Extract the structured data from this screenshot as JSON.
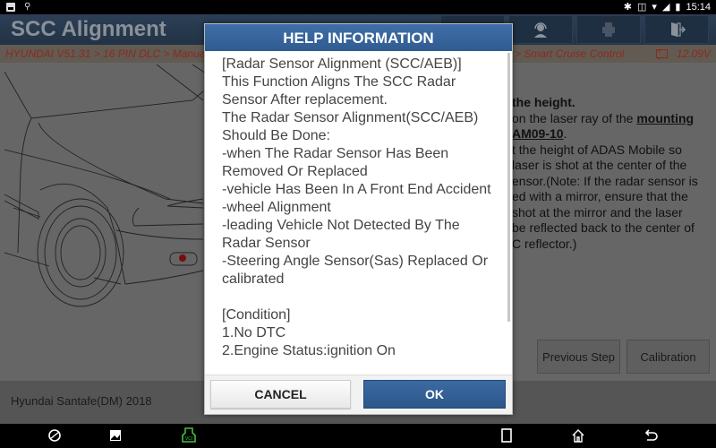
{
  "status_bar": {
    "time": "15:14",
    "left_icons": [
      "image-notification-icon",
      "usb-debug-icon"
    ],
    "right_icons": [
      "bluetooth-icon",
      "vibrate-icon",
      "wifi-icon",
      "signal-icon",
      "battery-icon"
    ]
  },
  "header": {
    "title": "SCC Alignment",
    "toolbar": [
      {
        "icon": "settings-icon"
      },
      {
        "icon": "support-headset-icon"
      },
      {
        "icon": "printer-icon"
      },
      {
        "icon": "exit-icon"
      }
    ]
  },
  "breadcrumb": {
    "left": "HYUNDAI V51.31 > 16 PIN DLC > Manual",
    "right": "> Smart Cruise Control",
    "voltage": "12.09V"
  },
  "instructions": {
    "line1_bold": "the height.",
    "line2_prefix": "on the laser ray of the ",
    "line2_link": "mounting",
    "line3_link": "AM09-10",
    "line3_suffix": ".",
    "rest": "t the height of ADAS Mobile so\n laser is shot at the center of the\nensor.(Note: If the radar sensor is\ned with a mirror, ensure that the\n shot at the mirror and the laser\n be reflected back to the center of\nC reflector.)"
  },
  "buttons": {
    "previous_step": "Previous Step",
    "calibration": "Calibration"
  },
  "footer": {
    "vehicle": "Hyundai Santafe(DM) 2018"
  },
  "dialog": {
    "title": "HELP INFORMATION",
    "body": "[Radar Sensor Alignment (SCC/AEB)]\nThis Function Aligns The SCC Radar Sensor After replacement.\nThe Radar Sensor Alignment(SCC/AEB) Should Be Done:\n-when The Radar Sensor Has Been Removed Or Replaced\n-vehicle Has Been In A Front End Accident\n-wheel Alignment\n-leading Vehicle Not Detected By The Radar Sensor\n-Steering Angle Sensor(Sas) Replaced Or calibrated\n\n[Condition]\n1.No DTC\n2.Engine Status:ignition On",
    "cancel_label": "CANCEL",
    "ok_label": "OK"
  },
  "nav_bar": {
    "icons": [
      "browser-icon",
      "gallery-icon",
      "vci-icon",
      "recent-apps-icon",
      "home-icon",
      "back-icon"
    ],
    "vci_color": "#3fbf3f"
  }
}
